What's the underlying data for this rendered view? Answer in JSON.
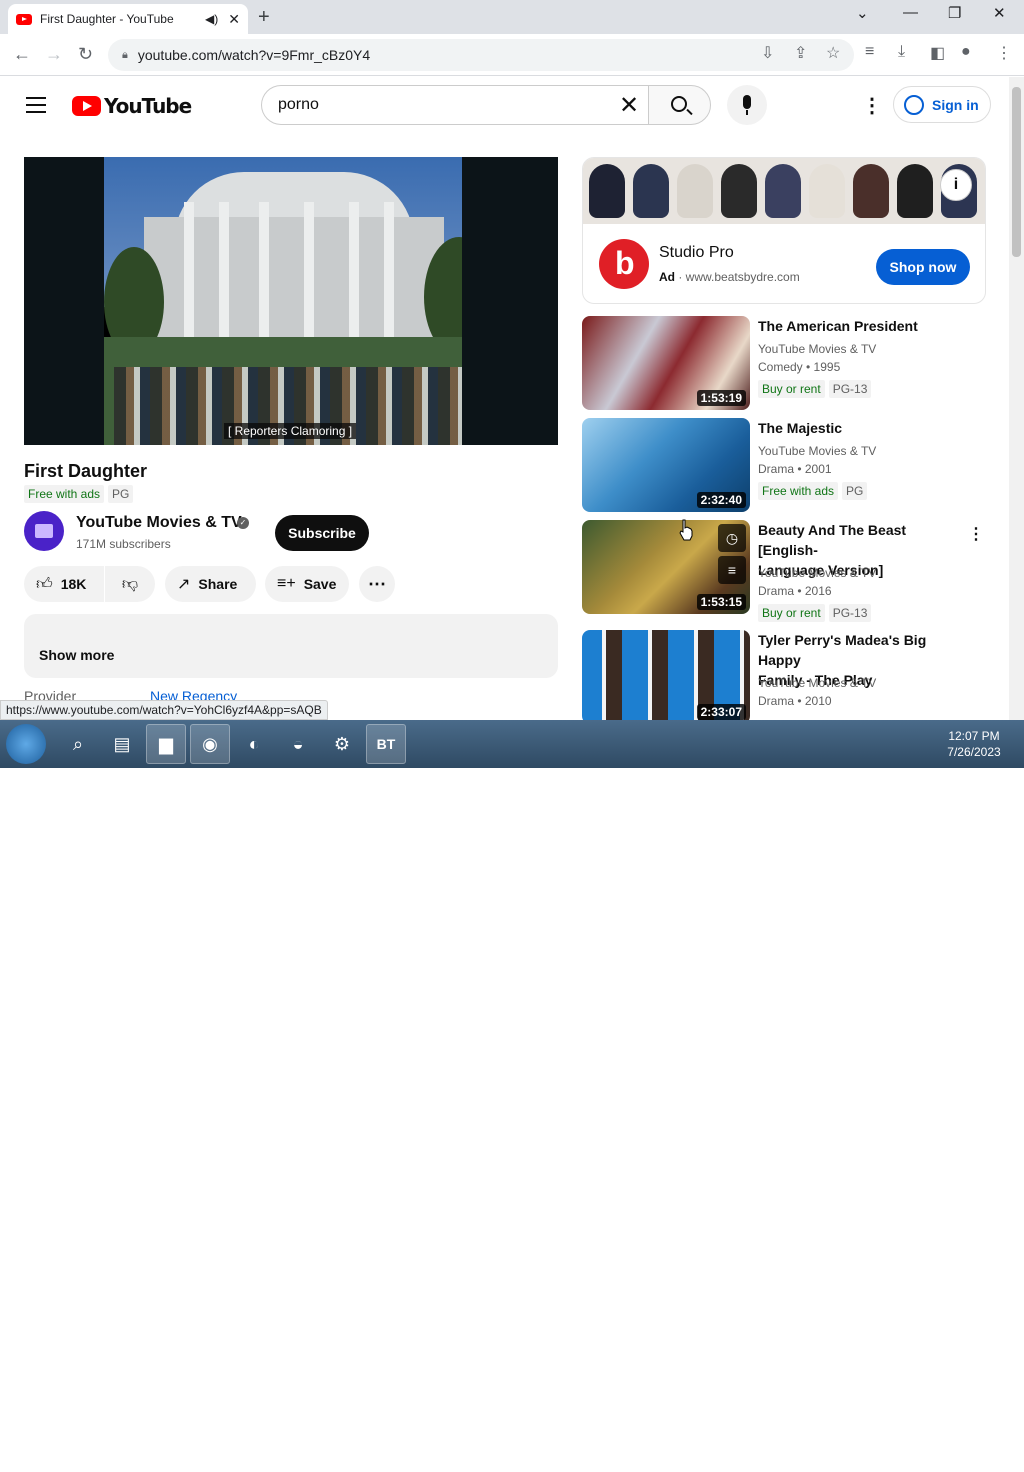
{
  "browser": {
    "tab_title": "First Daughter - YouTube",
    "url": "youtube.com/watch?v=9Fmr_cBz0Y4",
    "status_url": "https://www.youtube.com/watch?v=YohCl6yzf4A&pp=sAQB"
  },
  "youtube": {
    "logo_text": "YouTube",
    "search_value": "porno",
    "signin_label": "Sign in"
  },
  "video": {
    "caption": "[ Reporters Clamoring ]",
    "title": "First Daughter",
    "badges": [
      "Free with ads",
      "PG"
    ],
    "channel": "YouTube Movies & TV",
    "subscribers": "171M subscribers",
    "subscribe_label": "Subscribe",
    "likes": "18K",
    "share_label": "Share",
    "save_label": "Save",
    "show_more": "Show more",
    "provider_label": "Provider",
    "provider_value": "New Regency"
  },
  "ad": {
    "title": "Studio Pro",
    "ad_label": "Ad",
    "domain": "www.beatsbydre.com",
    "cta": "Shop now"
  },
  "recommendations": [
    {
      "title_lines": [
        "The American President"
      ],
      "channel": "YouTube Movies & TV",
      "meta": "Comedy • 1995",
      "badges": [
        "Buy or rent",
        "PG-13"
      ],
      "duration": "1:53:19"
    },
    {
      "title_lines": [
        "The Majestic"
      ],
      "channel": "YouTube Movies & TV",
      "meta": "Drama • 2001",
      "badges": [
        "Free with ads",
        "PG"
      ],
      "duration": "2:32:40"
    },
    {
      "title_lines": [
        "Beauty And The Beast [English-",
        "Language Version]"
      ],
      "channel": "YouTube Movies & TV",
      "meta": "Drama • 2016",
      "badges": [
        "Buy or rent",
        "PG-13"
      ],
      "duration": "1:53:15"
    },
    {
      "title_lines": [
        "Tyler Perry's Madea's Big Happy",
        "Family - The Play"
      ],
      "channel": "YouTube Movies & TV",
      "meta": "Drama • 2010",
      "badges": [],
      "duration": "2:33:07"
    }
  ],
  "taskbar": {
    "time": "12:07 PM",
    "date": "7/26/2023",
    "bt_label": "BT"
  }
}
